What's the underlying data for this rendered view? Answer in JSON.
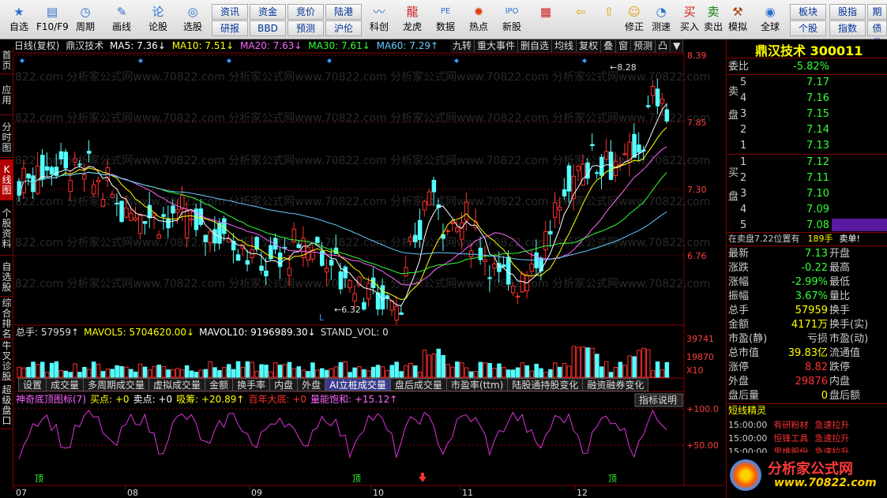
{
  "toolbar": {
    "buttons": [
      {
        "label": "自选",
        "icon": "star-icon",
        "glyph": "★"
      },
      {
        "label": "F10/F9",
        "icon": "document-icon",
        "glyph": "▤"
      },
      {
        "label": "周期",
        "icon": "clock-icon",
        "glyph": "◷"
      },
      {
        "label": "画线",
        "icon": "pencil-icon",
        "glyph": "✎"
      },
      {
        "label": "论股",
        "icon": "speech-icon",
        "glyph": "论"
      },
      {
        "label": "选股",
        "icon": "chart-search-icon",
        "glyph": "◎"
      },
      {
        "label": "科创",
        "icon": "line-chart-icon",
        "glyph": "〰"
      },
      {
        "label": "龙虎",
        "icon": "dragon-icon",
        "glyph": "龍"
      },
      {
        "label": "数据",
        "icon": "pe-icon",
        "glyph": "PE"
      },
      {
        "label": "热点",
        "icon": "fire-icon",
        "glyph": "✹"
      },
      {
        "label": "新股",
        "icon": "ipo-icon",
        "glyph": "IPO"
      },
      {
        "label": "",
        "icon": "color-grid-icon",
        "glyph": "▦"
      },
      {
        "label": "",
        "icon": "back-arrow-icon",
        "glyph": "⇦"
      },
      {
        "label": "",
        "icon": "up-arrow-icon",
        "glyph": "⇧"
      },
      {
        "label": "修正",
        "icon": "smiley-icon",
        "glyph": "☺"
      },
      {
        "label": "测速",
        "icon": "speed-icon",
        "glyph": "◔"
      },
      {
        "label": "买入",
        "icon": "buy-icon",
        "glyph": "买"
      },
      {
        "label": "卖出",
        "icon": "sell-icon",
        "glyph": "卖"
      },
      {
        "label": "模拟",
        "icon": "hammer-icon",
        "glyph": "⚒"
      },
      {
        "label": "全球",
        "icon": "globe-icon",
        "glyph": "◉"
      }
    ],
    "small": [
      "资讯",
      "资金",
      "竞价",
      "陆港",
      "研报",
      "BBD",
      "预测",
      "沪伦",
      "板块",
      "股指",
      "期货",
      "个股",
      "指数",
      "债券"
    ]
  },
  "sidebar": [
    "首页",
    "应用",
    "分时图",
    "K线图",
    "个股资料",
    "自选股",
    "综合排名",
    "牛叉诊股",
    "超级盘口"
  ],
  "chart": {
    "header": {
      "period": "日线(复权)",
      "name": "鼎汉技术",
      "ma5": "MA5: 7.36↓",
      "ma10": "MA10: 7.51↓",
      "ma20": "MA20: 7.63↓",
      "ma30": "MA30: 7.61↓",
      "ma60": "MA60: 7.29↑"
    },
    "top_buttons": [
      "九转",
      "重大事件",
      "删自选",
      "均线",
      "复权",
      "叠",
      "窗",
      "预测",
      "凸",
      "▼"
    ],
    "price_ticks": [
      "8.39",
      "7.85",
      "7.30",
      "6.76"
    ],
    "high_label": "8.28",
    "low_label": "6.32",
    "low_marker": "L",
    "watermark": "0822.com 分析家公式网www.70822.com 分析家公式网www.70822.com 分析家公式网www.70822.com 分析家公式网www.70822.com",
    "vol_header": {
      "vol": "总手: 57959↑",
      "mavol5": "MAVOL5: 5704620.00↓",
      "mavol10": "MAVOL10: 9196989.30↓",
      "stand": "STAND_VOL: 0"
    },
    "vol_ticks": [
      "39741",
      "19870",
      "X10"
    ],
    "tabs": [
      "设置",
      "成交量",
      "多周期成交量",
      "虚拟成交量",
      "金额",
      "换手率",
      "内盘",
      "外盘",
      "AI立桩成交量",
      "盘后成交量",
      "市盈率(ttm)",
      "陆股通持股变化",
      "融资融券变化"
    ],
    "active_tab": "AI立桩成交量",
    "ind_header": {
      "title": "神奇底顶图标(7)",
      "buy": "买点: +0",
      "sell": "卖点: +0",
      "chou": "吸筹: +20.89↑",
      "bottom": "百年大底: +0",
      "energy": "量能饱和: +15.12↑"
    },
    "ind_btn": "指标说明",
    "ind_ticks": [
      "+100.0",
      "+50.00"
    ],
    "ind_labels": [
      "顶",
      "顶",
      "顶"
    ],
    "months": [
      "07",
      "08",
      "09",
      "10",
      "11",
      "12"
    ]
  },
  "quote": {
    "title": "鼎汉技术 300011",
    "weibi_label": "委比",
    "weibi": "-5.82%",
    "sell_side": "卖盘",
    "buy_side": "买盘",
    "asks": [
      {
        "n": "5",
        "p": "7.17"
      },
      {
        "n": "4",
        "p": "7.16"
      },
      {
        "n": "3",
        "p": "7.15"
      },
      {
        "n": "2",
        "p": "7.14"
      },
      {
        "n": "1",
        "p": "7.13"
      }
    ],
    "bids": [
      {
        "n": "1",
        "p": "7.12"
      },
      {
        "n": "2",
        "p": "7.11"
      },
      {
        "n": "3",
        "p": "7.10"
      },
      {
        "n": "4",
        "p": "7.09"
      },
      {
        "n": "5",
        "p": "7.08"
      }
    ],
    "notice": "在卖盘7.22位置有",
    "notice_num": "189手",
    "notice_end": "卖单!",
    "stats": [
      [
        "最新",
        "7.13",
        "开盘",
        ""
      ],
      [
        "涨跌",
        "-0.22",
        "最高",
        ""
      ],
      [
        "涨幅",
        "-2.99%",
        "最低",
        ""
      ],
      [
        "振幅",
        "3.67%",
        "量比",
        ""
      ],
      [
        "总手",
        "57959",
        "换手",
        ""
      ],
      [
        "金额",
        "4171万",
        "换手(实)",
        ""
      ],
      [
        "市盈(静)",
        "亏损",
        "市盈(动)",
        ""
      ],
      [
        "总市值",
        "39.83亿",
        "流通值",
        ""
      ],
      [
        "涨停",
        "8.82",
        "跌停",
        ""
      ],
      [
        "外盘",
        "29876",
        "内盘",
        ""
      ],
      [
        "盘后量",
        "0",
        "盘后额",
        ""
      ]
    ],
    "sprite_title": "短线精灵",
    "sprites": [
      [
        "15:00:00",
        "有研粉材",
        "急速拉升"
      ],
      [
        "15:00:00",
        "恒锋工具",
        "急速拉升"
      ],
      [
        "15:00:00",
        "思维股份",
        "急速拉升"
      ]
    ],
    "logo_text": "分析家公式网",
    "logo_url": "www.70822.com"
  }
}
